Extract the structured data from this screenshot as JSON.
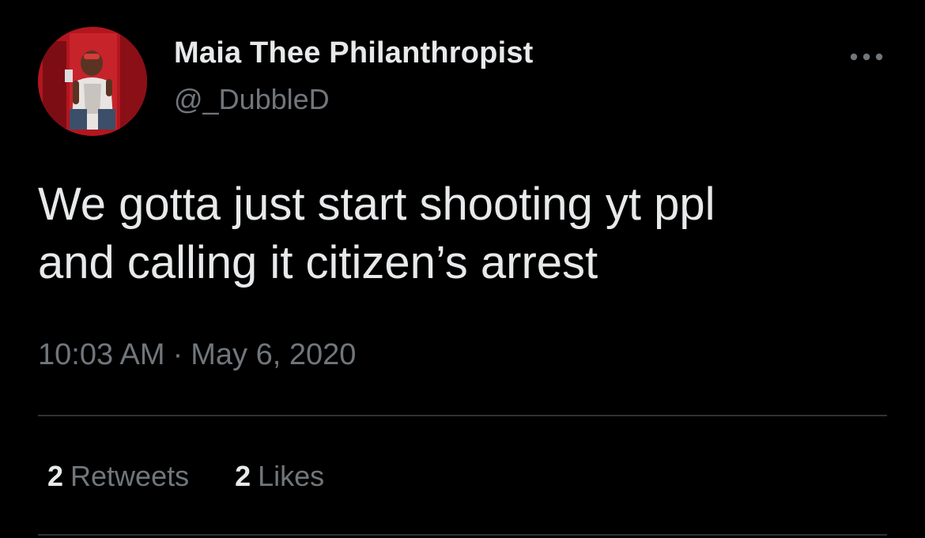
{
  "tweet": {
    "author": {
      "display_name": "Maia Thee Philanthropist",
      "handle": "@_DubbleD",
      "avatar_icon": "profile-photo"
    },
    "more_icon": "more-horizontal-icon",
    "text_lines": [
      "We gotta just start shooting yt ppl",
      "and calling it citizen’s arrest"
    ],
    "time": "10:03 AM",
    "separator": "·",
    "date": "May 6, 2020",
    "stats": {
      "retweets_count": "2",
      "retweets_label": "Retweets",
      "likes_count": "2",
      "likes_label": "Likes"
    }
  },
  "colors": {
    "background": "#000000",
    "primary_text": "#e7e9ea",
    "secondary_text": "#71767b",
    "divider": "#2f3336"
  }
}
